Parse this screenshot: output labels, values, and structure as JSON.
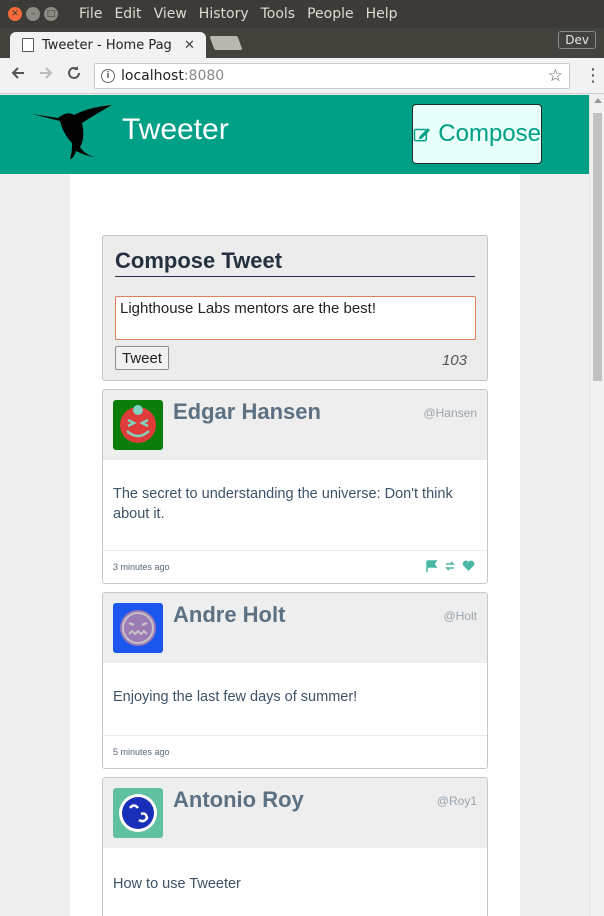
{
  "os": {
    "menu": [
      "File",
      "Edit",
      "View",
      "History",
      "Tools",
      "People",
      "Help"
    ]
  },
  "browser": {
    "tab_title": "Tweeter - Home Pag",
    "tab_close": "✕",
    "profile_label": "Dev",
    "url_host": "localhost",
    "url_port": ":8080"
  },
  "site": {
    "title": "Tweeter",
    "compose_label": "Compose"
  },
  "new_tweet": {
    "heading": "Compose Tweet",
    "text": "Lighthouse Labs mentors are the best!",
    "submit_label": "Tweet",
    "counter": "103"
  },
  "tweets": [
    {
      "name": "Edgar Hansen",
      "handle": "@Hansen",
      "text": "The secret to understanding the universe: Don't think about it.",
      "time": "3 minutes ago",
      "avatar_bg": "#0a7d0a",
      "avatar_face": "#e03b3b"
    },
    {
      "name": "Andre Holt",
      "handle": "@Holt",
      "text": "Enjoying the last few days of summer!",
      "time": "5 minutes ago",
      "avatar_bg": "#1b56ee",
      "avatar_face": "#9b7bb3"
    },
    {
      "name": "Antonio Roy",
      "handle": "@Roy1",
      "text": "How to use Tweeter",
      "time": "",
      "avatar_bg": "#5fc1a0",
      "avatar_face": "#1a2fb8"
    }
  ],
  "colors": {
    "accent": "#00a087",
    "heading": "#243040",
    "name": "#5c7183"
  }
}
